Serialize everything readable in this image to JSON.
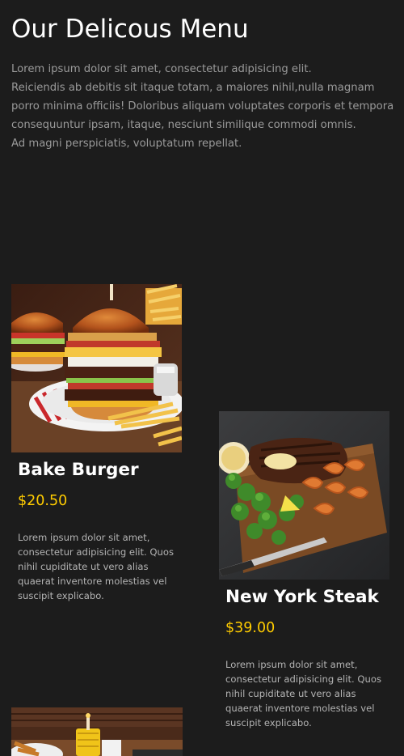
{
  "header": {
    "title": "Our Delicous Menu",
    "intro_lines": [
      "Lorem ipsum dolor sit amet, consectetur adipisicing elit.",
      "Reiciendis ab debitis sit itaque totam, a maiores nihil,nulla magnam",
      "porro minima officiis! Doloribus aliquam voluptates corporis et tempora",
      "consequuntur ipsam, itaque, nesciunt similique commodi omnis.",
      "Ad magni perspiciatis, voluptatum repellat."
    ]
  },
  "menu": {
    "items": [
      {
        "name": "Bake Burger",
        "price": "$20.50",
        "description": "Lorem ipsum dolor sit amet, consectetur adipisicing elit. Quos nihil cupiditate ut vero alias quaerat inventore molestias vel suscipit explicabo."
      },
      {
        "name": "New York Steak",
        "price": "$39.00",
        "description": "Lorem ipsum dolor sit amet, consectetur adipisicing elit. Quos nihil cupiditate ut vero alias quaerat inventore molestias vel suscipit explicabo."
      }
    ]
  },
  "colors": {
    "background": "#1c1c1c",
    "title": "#ffffff",
    "body_text": "#9a9a9a",
    "price": "#ffcc00"
  }
}
